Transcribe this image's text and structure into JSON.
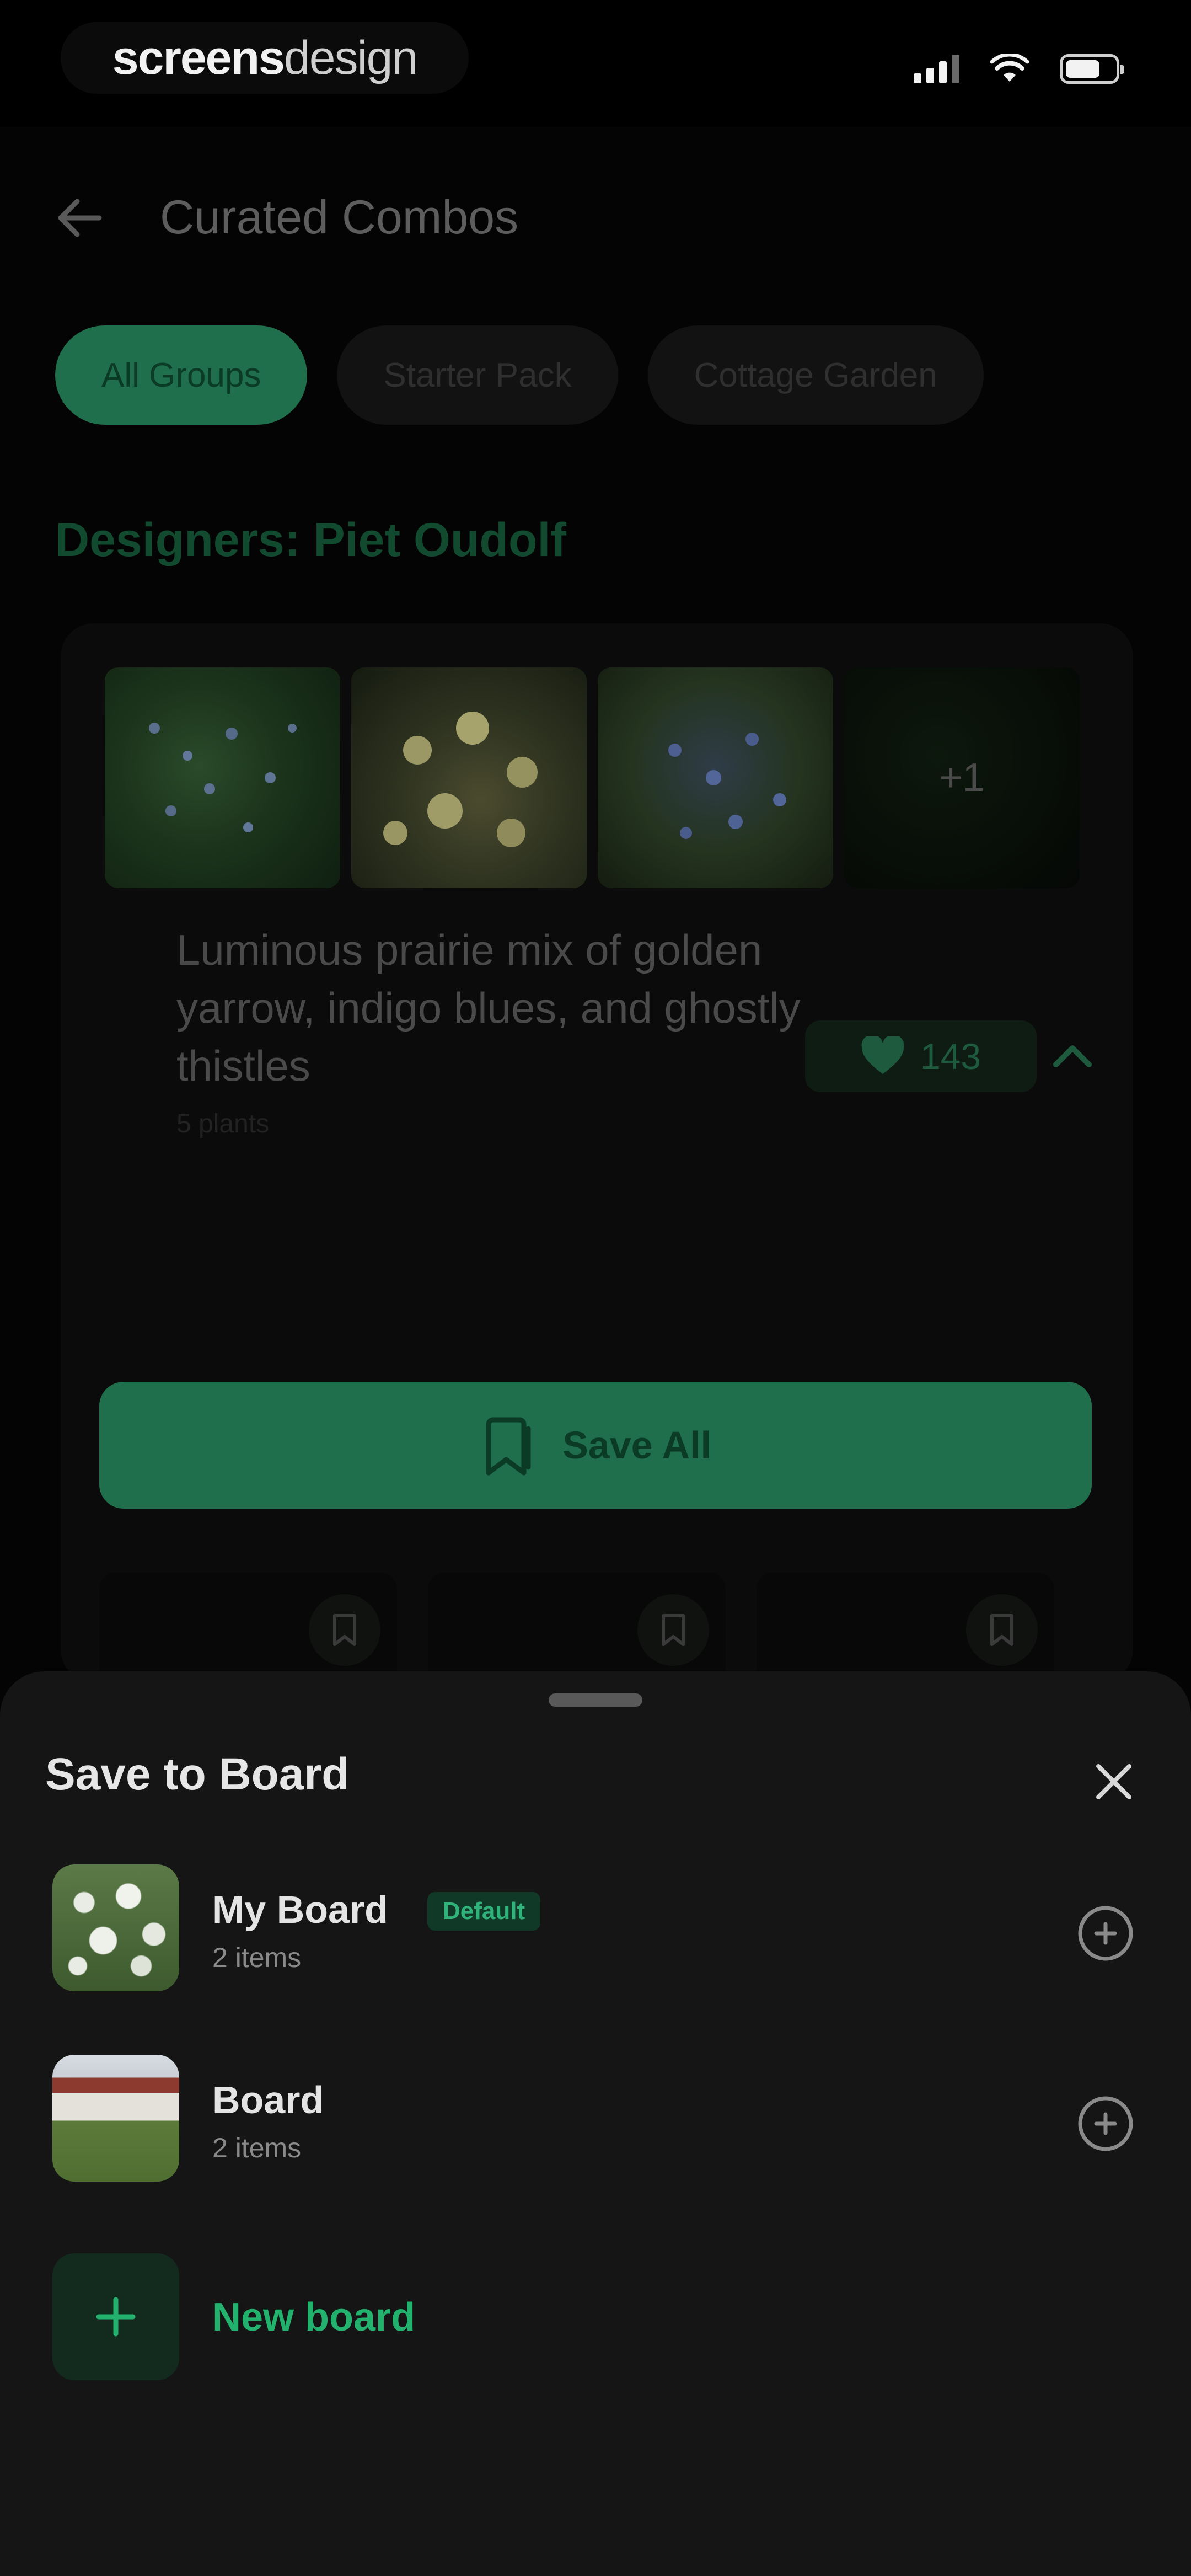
{
  "status_bar": {
    "brand_part1": "screens",
    "brand_part2": "design"
  },
  "header": {
    "title": "Curated Combos"
  },
  "filters": [
    {
      "label": "All Groups",
      "active": true
    },
    {
      "label": "Starter Pack",
      "active": false
    },
    {
      "label": "Cottage Garden",
      "active": false
    }
  ],
  "section": {
    "title": "Designers: Piet Oudolf"
  },
  "combo": {
    "more_count": "+1",
    "description": "Luminous prairie mix of golden yarrow, indigo blues, and ghostly thistles",
    "meta": "5 plants",
    "likes": "143",
    "save_all_label": "Save All"
  },
  "sheet": {
    "title": "Save to Board",
    "boards": [
      {
        "name": "My Board",
        "count": "2 items",
        "badge": "Default"
      },
      {
        "name": "Board",
        "count": "2 items"
      }
    ],
    "new_board_label": "New board"
  },
  "colors": {
    "accent": "#1f6e4c",
    "accent_text": "#23b26e",
    "sheet_bg": "#151515",
    "page_bg": "#030403"
  },
  "icons": [
    "back-arrow-icon",
    "heart-icon",
    "chevron-up-icon",
    "bookmark-icon",
    "close-icon",
    "plus-circle-icon",
    "plus-icon"
  ]
}
